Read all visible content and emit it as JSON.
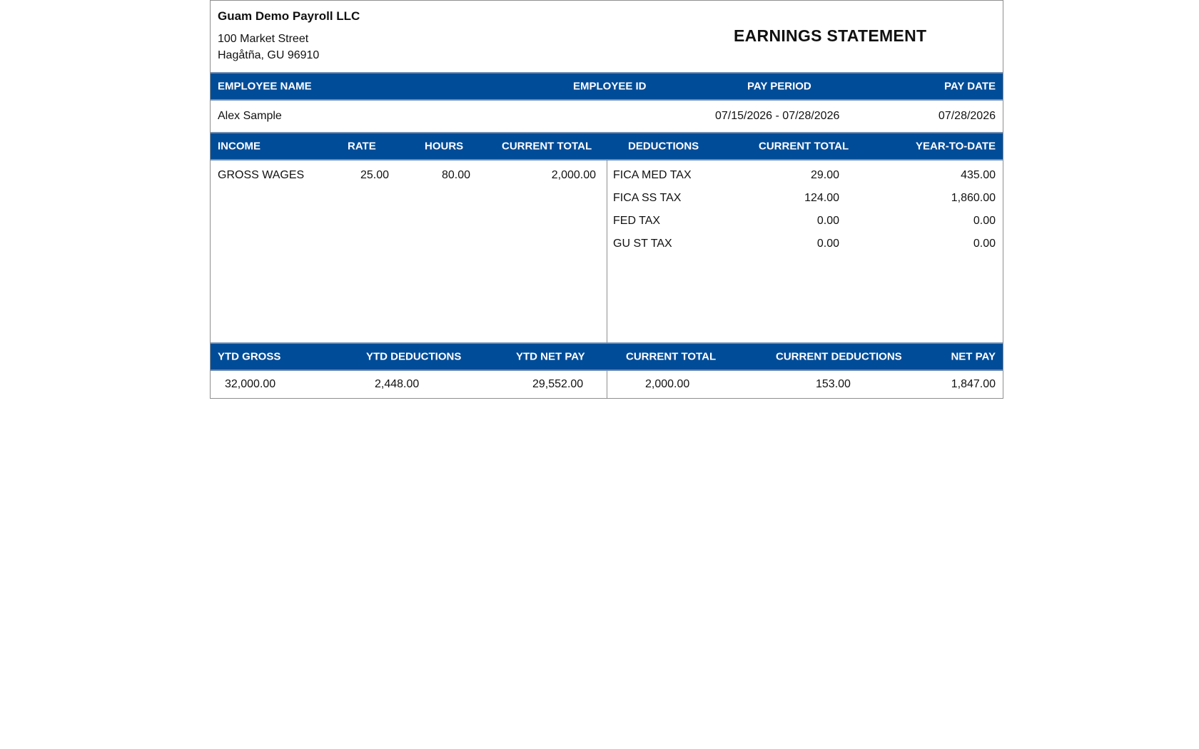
{
  "company": {
    "name": "Guam Demo Payroll LLC",
    "address_line1": "100 Market Street",
    "address_line2": "Hagåtña, GU 96910"
  },
  "title": "EARNINGS STATEMENT",
  "employee_header": {
    "name": "EMPLOYEE NAME",
    "id": "EMPLOYEE ID",
    "period": "PAY PERIOD",
    "date": "PAY DATE"
  },
  "employee": {
    "name": "Alex Sample",
    "id": "",
    "period": "07/15/2026 - 07/28/2026",
    "date": "07/28/2026"
  },
  "detail_header": {
    "income": "INCOME",
    "rate": "RATE",
    "hours": "HOURS",
    "income_current": "CURRENT TOTAL",
    "deductions": "DEDUCTIONS",
    "deduction_current": "CURRENT TOTAL",
    "ytd": "YEAR-TO-DATE"
  },
  "income": [
    {
      "label": "GROSS WAGES",
      "rate": "25.00",
      "hours": "80.00",
      "current": "2,000.00"
    }
  ],
  "deductions": [
    {
      "label": "FICA MED TAX",
      "current": "29.00",
      "ytd": "435.00"
    },
    {
      "label": "FICA SS TAX",
      "current": "124.00",
      "ytd": "1,860.00"
    },
    {
      "label": "FED TAX",
      "current": "0.00",
      "ytd": "0.00"
    },
    {
      "label": "GU ST TAX",
      "current": "0.00",
      "ytd": "0.00"
    }
  ],
  "summary_header": {
    "ytd_gross": "YTD GROSS",
    "ytd_deductions": "YTD DEDUCTIONS",
    "ytd_net": "YTD NET PAY",
    "current_total": "CURRENT TOTAL",
    "current_deductions": "CURRENT DEDUCTIONS",
    "net_pay": "NET PAY"
  },
  "summary": {
    "ytd_gross": "32,000.00",
    "ytd_deductions": "2,448.00",
    "ytd_net": "29,552.00",
    "current_total": "2,000.00",
    "current_deductions": "153.00",
    "net_pay": "1,847.00"
  },
  "colors": {
    "header_bar": "#014c98"
  }
}
